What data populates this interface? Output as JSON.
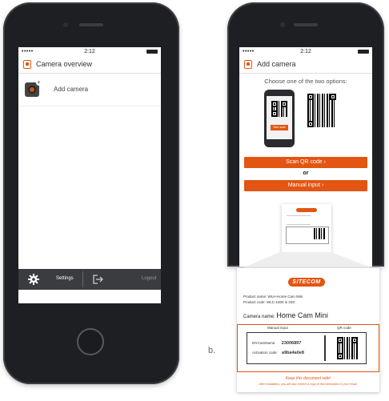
{
  "left_phone": {
    "status": {
      "carrier": "•••••",
      "time": "2:12"
    },
    "title": "Camera overview",
    "add_camera_label": "Add camera",
    "settings_label": "Settings",
    "logout_label": "Logout"
  },
  "right_phone": {
    "status": {
      "carrier": "•••••",
      "time": "2:12"
    },
    "title": "Add camera",
    "instruction": "Choose one of the two options:",
    "phone_scan_label": "Start scan",
    "scan_qr_button": "Scan QR code ›",
    "or_label": "or",
    "manual_input_button": "Manual input ›"
  },
  "document": {
    "brand": "SITECOM",
    "small_line1": "Product name: WLH-Home Cam Mini",
    "small_line2": "Product code: WLC-1000 in 033",
    "camera_name_label": "Camera name:",
    "camera_name_value": "Home Cam Mini",
    "manual_input_header": "Manual input",
    "qr_code_header": "QR code",
    "mycam_label": "MYCamName:",
    "mycam_value": "23006897",
    "activation_label": "Activation code:",
    "activation_value": "a9ba4a0e8",
    "keep_safe": "Keep this document safe!",
    "keep_safe_sub": "After installation, you will also receive a copy of this information in your email."
  },
  "caption_label": "b.",
  "colors": {
    "accent": "#e25512",
    "dock": "#3a3c40"
  }
}
